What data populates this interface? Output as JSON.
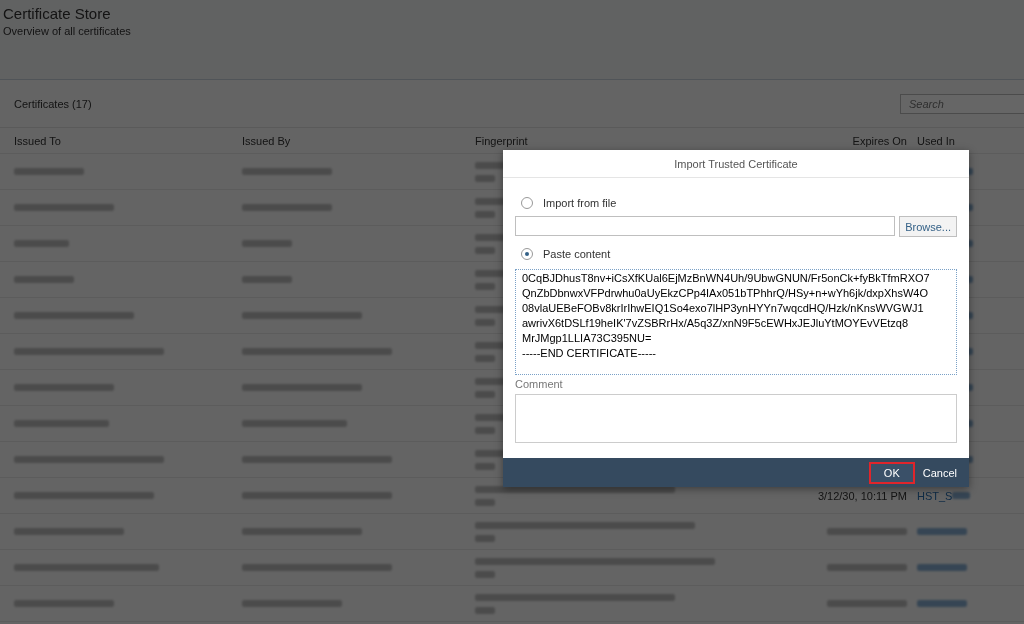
{
  "page": {
    "title": "Certificate Store",
    "subtitle": "Overview of all certificates"
  },
  "table": {
    "title": "Certificates (17)",
    "search": {
      "placeholder": "Search"
    },
    "columns": [
      "Issued To",
      "Issued By",
      "Fingerprint",
      "Expires On",
      "Used In"
    ],
    "rows": [
      {
        "kind": "covered"
      },
      {
        "kind": "covered"
      },
      {
        "kind": "covered"
      },
      {
        "kind": "covered"
      },
      {
        "kind": "covered"
      },
      {
        "kind": "covered"
      },
      {
        "kind": "covered"
      },
      {
        "kind": "covered"
      },
      {
        "kind": "covered"
      },
      {
        "kind": "partial",
        "expires_on": "3/12/30, 10:11 PM",
        "used_in": "HST_S"
      },
      {
        "kind": "redacted"
      },
      {
        "kind": "redacted"
      },
      {
        "kind": "redacted"
      }
    ]
  },
  "dialog": {
    "title": "Import Trusted Certificate",
    "options": [
      {
        "label": "Import from file",
        "selected": false
      },
      {
        "label": "Paste content",
        "selected": true
      }
    ],
    "browse_button": "Browse...",
    "content_lines": [
      "0CqBJDhusT8nv+iCsXfKUal6EjMzBnWN4Uh/9UbwGNUN/Fr5onCk+fyBkTfmRXO7",
      "QnZbDbnwxVFPdrwhu0aUyEkzCPp4IAx051bTPhhrQ/HSy+n+wYh6jk/dxpXhsW4O",
      "08vlaUEBeFOBv8krIrIhwEIQ1So4exo7lHP3ynHYYn7wqcdHQ/Hzk/nKnsWVGWJ1",
      "awrivX6tDSLf19heIK'7vZSBRrHx/A5q3Z/xnN9F5cEWHxJEJluYtMOYEvVEtzq8",
      "MrJMgp1LLIA73C395NU=",
      "-----END CERTIFICATE-----"
    ],
    "comment_label": "Comment",
    "buttons": [
      {
        "label": "OK",
        "kind": "primary",
        "highlighted": true
      },
      {
        "label": "Cancel",
        "kind": "plain",
        "highlighted": false
      }
    ]
  }
}
